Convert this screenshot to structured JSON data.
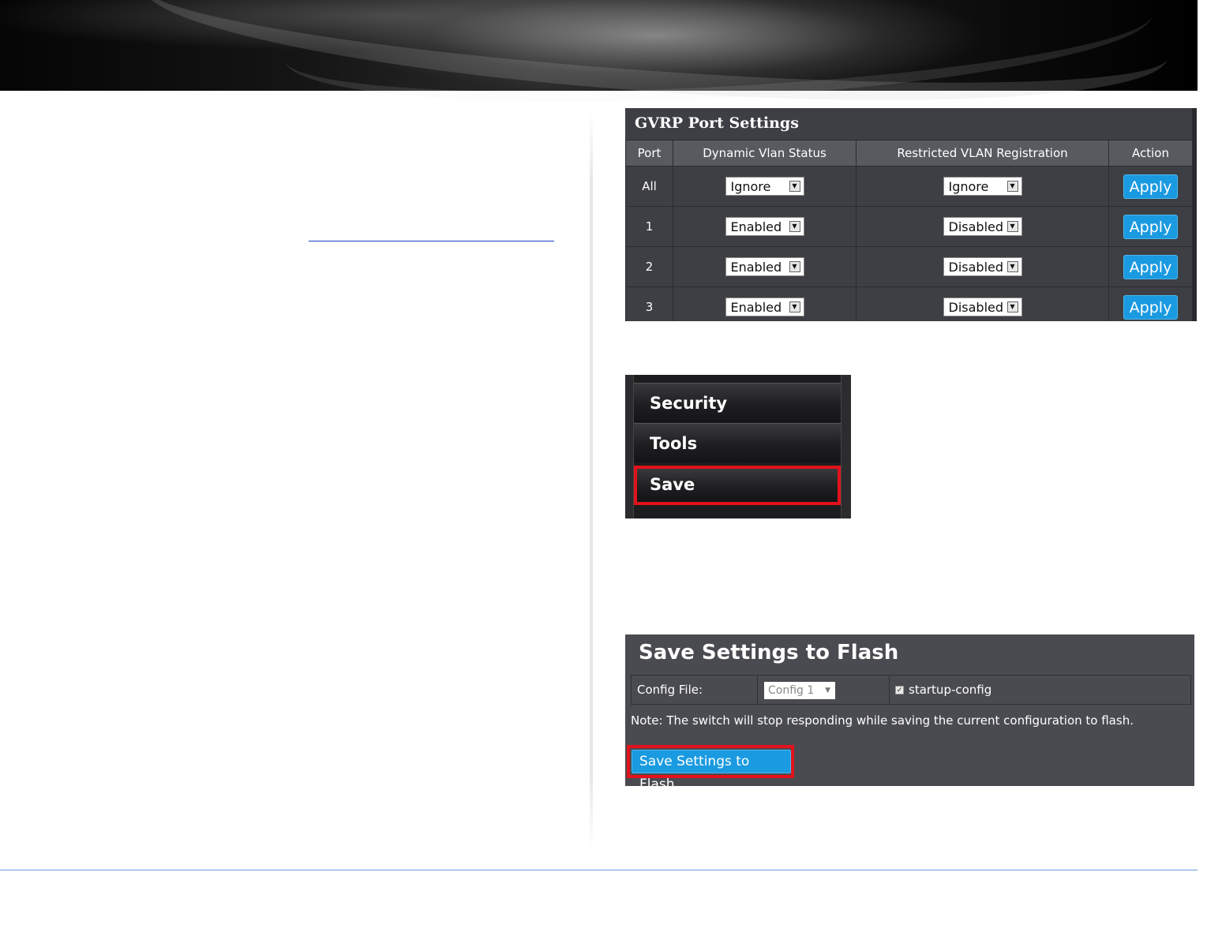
{
  "gvrp": {
    "title": "GVRP Port Settings",
    "columns": [
      "Port",
      "Dynamic Vlan Status",
      "Restricted VLAN Registration",
      "Action"
    ],
    "rows": [
      {
        "port": "All",
        "dynamic": "Ignore",
        "restricted": "Ignore",
        "action": "Apply"
      },
      {
        "port": "1",
        "dynamic": "Enabled",
        "restricted": "Disabled",
        "action": "Apply"
      },
      {
        "port": "2",
        "dynamic": "Enabled",
        "restricted": "Disabled",
        "action": "Apply"
      },
      {
        "port": "3",
        "dynamic": "Enabled",
        "restricted": "Disabled",
        "action": "Apply"
      }
    ]
  },
  "menu": {
    "items": [
      "Security",
      "Tools",
      "Save"
    ],
    "highlighted": "Save"
  },
  "flash": {
    "title": "Save Settings to Flash",
    "config_label": "Config File:",
    "config_value": "Config 1",
    "checkbox_label": "startup-config",
    "checkbox_checked": true,
    "note": "Note: The switch will stop responding while saving the current configuration to flash.",
    "button_label": "Save Settings to Flash"
  },
  "colors": {
    "accent_button": "#1a9ae0",
    "highlight_border": "#e3121c",
    "panel_bg": "#3e3f44"
  }
}
